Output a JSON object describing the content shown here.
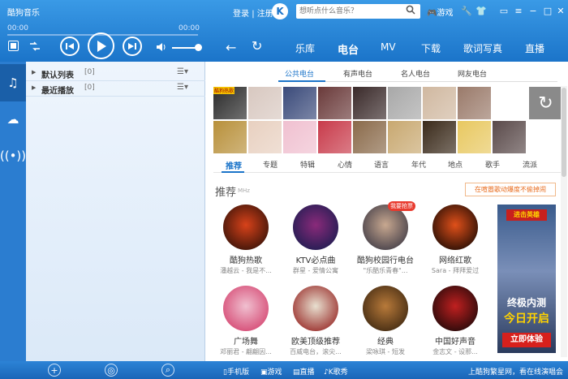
{
  "app": {
    "title": "酷狗音乐"
  },
  "player": {
    "time_elapsed": "00:00",
    "time_total": "00:00",
    "progress": 0
  },
  "account": {
    "login": "登录",
    "separator": "|",
    "register": "注册",
    "logo_letter": "K"
  },
  "search": {
    "placeholder": "想听点什么音乐？"
  },
  "topbar": {
    "game_label": "游戏"
  },
  "nav": {
    "tabs": [
      {
        "label": "乐库"
      },
      {
        "label": "电台"
      },
      {
        "label": "MV"
      },
      {
        "label": "下载"
      },
      {
        "label": "歌词写真"
      },
      {
        "label": "直播"
      }
    ],
    "active": "电台"
  },
  "playlists": [
    {
      "label": "默认列表",
      "count": "[0]"
    },
    {
      "label": "最近播放",
      "count": "[0]"
    }
  ],
  "radio_tabs": [
    {
      "label": "公共电台"
    },
    {
      "label": "有声电台"
    },
    {
      "label": "名人电台"
    },
    {
      "label": "网友电台"
    }
  ],
  "thumbnail_badge": "酷狗热歌",
  "categories": [
    {
      "label": "推荐"
    },
    {
      "label": "专题"
    },
    {
      "label": "特辑"
    },
    {
      "label": "心情"
    },
    {
      "label": "语言"
    },
    {
      "label": "年代"
    },
    {
      "label": "地点"
    },
    {
      "label": "歌手"
    },
    {
      "label": "流派"
    }
  ],
  "section": {
    "title": "推荐",
    "subtitle": "MHz",
    "link": "在喧嚣歌动爆度不偷掉闹"
  },
  "radios": [
    {
      "name": "酷狗热歌",
      "desc": "潘越云 - 我是不...",
      "color1": "#1a0a05",
      "color2": "#d8421a"
    },
    {
      "name": "KTV必点曲",
      "desc": "群星 - 爱情公寓",
      "color1": "#0a1a4a",
      "color2": "#8a2a7a"
    },
    {
      "name": "酷狗校园行电台",
      "desc": "\"乐酷乐青春\"...",
      "color1": "#2a2a3a",
      "color2": "#c8a890",
      "badge": "我要抢票"
    },
    {
      "name": "网络红歌",
      "desc": "Sara - 拜拜爱过",
      "color1": "#000000",
      "color2": "#e0501a"
    },
    {
      "name": "广场舞",
      "desc": "邓丽君 - 翩翩因...",
      "color1": "#d03060",
      "color2": "#f0c0d0"
    },
    {
      "name": "欧美顶级推荐",
      "desc": "百威电台，滚尖...",
      "color1": "#8a0a0a",
      "color2": "#e8e0d0"
    },
    {
      "name": "经典",
      "desc": "梁咏琪 - 短发",
      "color1": "#2a1a0a",
      "color2": "#b87a3a"
    },
    {
      "name": "中国好声音",
      "desc": "金志文 - 设那...",
      "color1": "#050505",
      "color2": "#c02020"
    }
  ],
  "ad": {
    "badge": "进击英雄",
    "line1": "终极内测",
    "line2": "今日开启",
    "button": "立即体验"
  },
  "footer": {
    "phone": "手机版",
    "game": "游戏",
    "live": "直播",
    "ksong": "K歌秀",
    "right": "上酷狗繁星网，看在线演唱会"
  },
  "thumb_colors": [
    "#2a2a2a",
    "#d8c8c0",
    "#3a4a7a",
    "#6a3a3a",
    "#3a2a2a",
    "#a8a8a8",
    "#d0b8a0",
    "#9a7a6a",
    "#4a4a4a",
    "#b8903a",
    "#e8d0c0",
    "#f0c0d0",
    "#c83a4a",
    "#8a6a4a",
    "#c8a870",
    "#3a2a1a",
    "#e8c860",
    "#5a4a4a"
  ],
  "colors": {
    "accent": "#1b74c9",
    "header_top": "#3a9ae6"
  }
}
